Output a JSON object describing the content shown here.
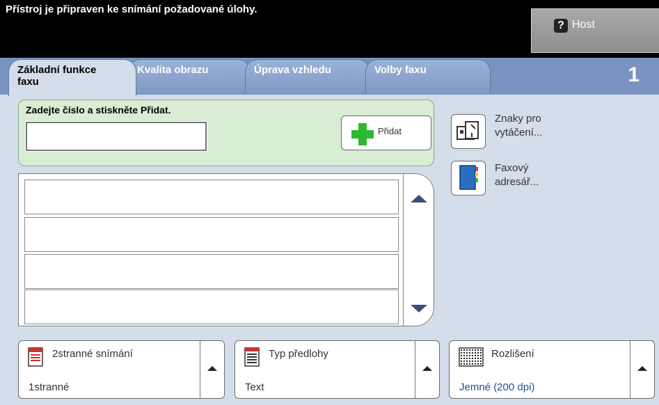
{
  "status": {
    "message": "Přístroj je připraven ke snímání požadované úlohy."
  },
  "host": {
    "label": "Host",
    "icon": "help-icon"
  },
  "tabs": [
    {
      "label1": "Základní funkce",
      "label2": "faxu",
      "active": true
    },
    {
      "label1": "Kvalita obrazu",
      "label2": ""
    },
    {
      "label1": "Úprava vzhledu",
      "label2": ""
    },
    {
      "label1": "Volby faxu",
      "label2": ""
    }
  ],
  "page_number": "1",
  "entry": {
    "label": "Zadejte číslo a stiskněte Přidat.",
    "value": "",
    "add_label": "Přidat"
  },
  "side": {
    "dial_chars": {
      "line1": "Znaky pro",
      "line2": "vytáčení..."
    },
    "fax_book": {
      "line1": "Faxový",
      "line2": "adresář..."
    }
  },
  "options": [
    {
      "title": "2stranné snímání",
      "value": "1stranné",
      "icon": "two-sided-icon"
    },
    {
      "title": "Typ předlohy",
      "value": "Text",
      "icon": "document-type-icon"
    },
    {
      "title": "Rozlišení",
      "value": "Jemné (200 dpi)",
      "icon": "resolution-icon"
    }
  ],
  "colors": {
    "accent_green": "#2db82d",
    "value_blue": "#234f9a"
  }
}
